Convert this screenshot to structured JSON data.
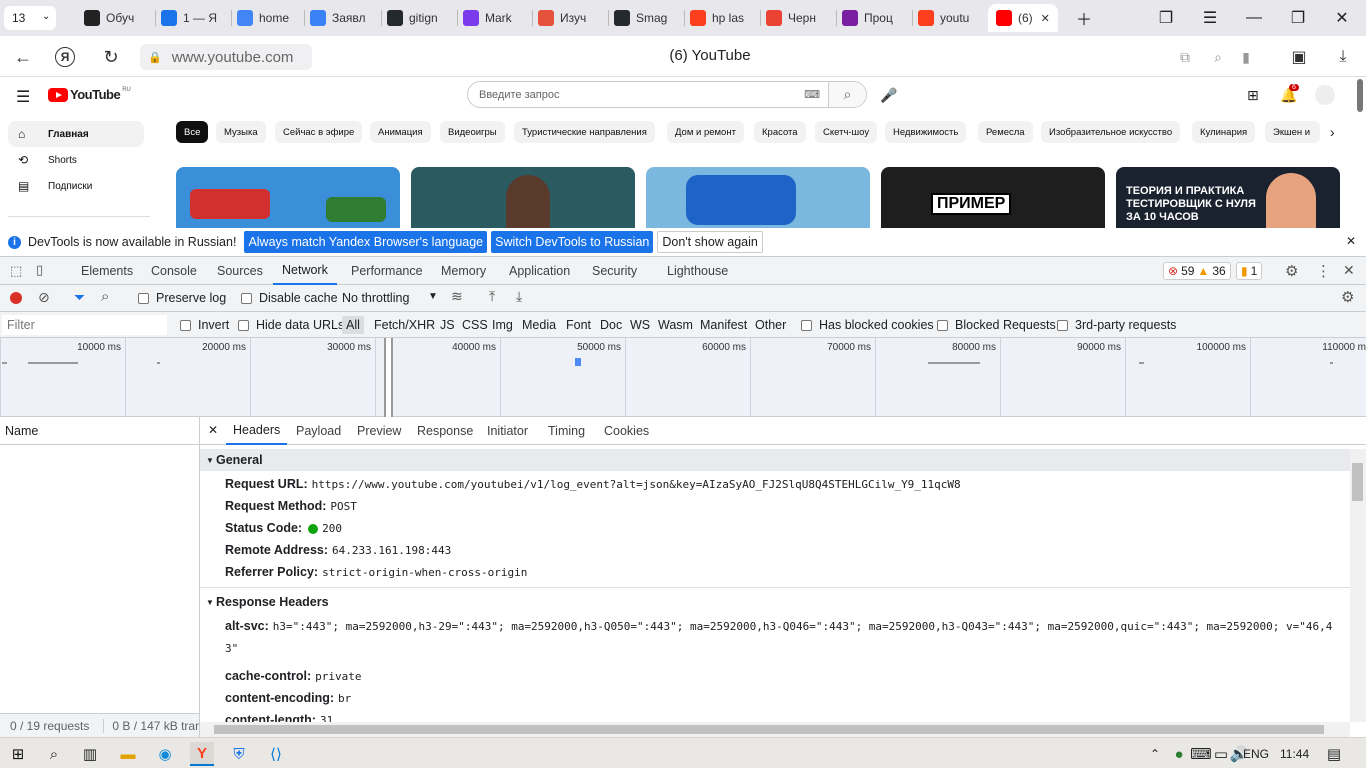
{
  "browser": {
    "tab_count": "13",
    "tabs": [
      {
        "label": "Обуч",
        "color": "#222222",
        "icon": "openai-icon"
      },
      {
        "label": "1 — Я",
        "color": "#1a73e8",
        "icon": "wave-icon"
      },
      {
        "label": "home",
        "color": "#4285f4",
        "icon": "doc-icon"
      },
      {
        "label": "Заявл",
        "color": "#3b82f6",
        "icon": "cube-icon"
      },
      {
        "label": "gitign",
        "color": "#24292f",
        "icon": "github-icon"
      },
      {
        "label": "Mark",
        "color": "#7c3aed",
        "icon": "markdown-icon"
      },
      {
        "label": "Изуч",
        "color": "#e5533d",
        "icon": "puzzle-icon"
      },
      {
        "label": "Smag",
        "color": "#24292f",
        "icon": "github-icon"
      },
      {
        "label": "hp las",
        "color": "#fc3f1d",
        "icon": "yandex-icon"
      },
      {
        "label": "Черн",
        "color": "#ea4335",
        "icon": "gmail-icon"
      },
      {
        "label": "Проц",
        "color": "#7b1fa2",
        "icon": "app-icon"
      },
      {
        "label": "youtu",
        "color": "#fc3f1d",
        "icon": "yandex-icon"
      },
      {
        "label": "(6)",
        "color": "#ff0000",
        "icon": "youtube-icon"
      }
    ],
    "url": "www.youtube.com",
    "page_title": "(6) YouTube"
  },
  "youtube": {
    "logo_text": "YouTube",
    "logo_region": "RU",
    "search_placeholder": "Введите запрос",
    "notification_count": "6",
    "sidebar": [
      {
        "label": "Главная",
        "icon": "home-icon"
      },
      {
        "label": "Shorts",
        "icon": "shorts-icon"
      },
      {
        "label": "Подписки",
        "icon": "subscriptions-icon"
      }
    ],
    "chips": [
      "Все",
      "Музыка",
      "Сейчас в эфире",
      "Анимация",
      "Видеоигры",
      "Туристические направления",
      "Дом и ремонт",
      "Красота",
      "Скетч-шоу",
      "Недвижимость",
      "Ремесла",
      "Изобразительное искусство",
      "Кулинария",
      "Экшен и"
    ],
    "thumbs": [
      {
        "color": "#3a8fd8",
        "text": ""
      },
      {
        "color": "#2b5a60",
        "text": ""
      },
      {
        "color": "#7ab8e0",
        "text": ""
      },
      {
        "color": "#1e1e1e",
        "text": "ПРИМЕР"
      },
      {
        "color": "#1a2230",
        "text": "ТЕОРИЯ И ПРАКТИКА ТЕСТИРОВЩИК С НУЛЯ ЗА 10 ЧАСОВ"
      }
    ]
  },
  "infobar": {
    "message": "DevTools is now available in Russian!",
    "btn1": "Always match Yandex Browser's language",
    "btn2": "Switch DevTools to Russian",
    "btn3": "Don't show again"
  },
  "devtools": {
    "tabs": [
      "Elements",
      "Console",
      "Sources",
      "Network",
      "Performance",
      "Memory",
      "Application",
      "Security",
      "Lighthouse"
    ],
    "active_tab": "Network",
    "errors": "59",
    "warnings": "36",
    "issues": "1",
    "preserve_log": "Preserve log",
    "disable_cache": "Disable cache",
    "throttling": "No throttling",
    "filter_placeholder": "Filter",
    "invert": "Invert",
    "hide_data_urls": "Hide data URLs",
    "filter_types": [
      "All",
      "Fetch/XHR",
      "JS",
      "CSS",
      "Img",
      "Media",
      "Font",
      "Doc",
      "WS",
      "Wasm",
      "Manifest",
      "Other"
    ],
    "has_blocked_cookies": "Has blocked cookies",
    "blocked_requests": "Blocked Requests",
    "third_party": "3rd-party requests",
    "timeline_ticks": [
      "10000 ms",
      "20000 ms",
      "30000 ms",
      "40000 ms",
      "50000 ms",
      "60000 ms",
      "70000 ms",
      "80000 ms",
      "90000 ms",
      "100000 ms",
      "110000 ms"
    ],
    "name_header": "Name",
    "requests_summary": "0 / 19 requests",
    "transfer_summary": "0 B / 147 kB tran",
    "detail_tabs": [
      "Headers",
      "Payload",
      "Preview",
      "Response",
      "Initiator",
      "Timing",
      "Cookies"
    ],
    "general_title": "General",
    "general": [
      {
        "k": "Request URL:",
        "v": "https://www.youtube.com/youtubei/v1/log_event?alt=json&key=AIzaSyAO_FJ2SlqU8Q4STEHLGCilw_Y9_11qcW8"
      },
      {
        "k": "Request Method:",
        "v": "POST"
      },
      {
        "k": "Status Code:",
        "v": "200"
      },
      {
        "k": "Remote Address:",
        "v": "64.233.161.198:443"
      },
      {
        "k": "Referrer Policy:",
        "v": "strict-origin-when-cross-origin"
      }
    ],
    "response_title": "Response Headers",
    "response": [
      {
        "k": "alt-svc:",
        "v": "h3=\":443\"; ma=2592000,h3-29=\":443\"; ma=2592000,h3-Q050=\":443\"; ma=2592000,h3-Q046=\":443\"; ma=2592000,h3-Q043=\":443\"; ma=2592000,quic=\":443\"; ma=2592000; v=\"46,4",
        "v2": "3\""
      },
      {
        "k": "cache-control:",
        "v": "private"
      },
      {
        "k": "content-encoding:",
        "v": "br"
      },
      {
        "k": "content-length:",
        "v": "31"
      }
    ]
  },
  "taskbar": {
    "lang": "ENG",
    "time": "11:44"
  }
}
